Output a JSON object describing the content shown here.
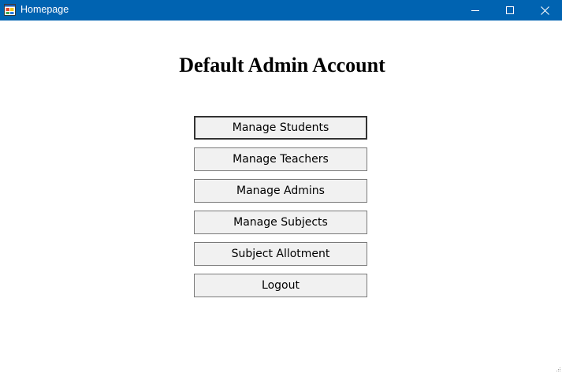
{
  "window": {
    "title": "Homepage",
    "titlebar_color": "#0063b1",
    "controls": {
      "minimize_icon": "minimize-icon",
      "maximize_icon": "maximize-icon",
      "close_icon": "close-icon"
    }
  },
  "main": {
    "heading": "Default Admin Account",
    "buttons": [
      {
        "label": "Manage Students"
      },
      {
        "label": "Manage Teachers"
      },
      {
        "label": "Manage Admins"
      },
      {
        "label": "Manage Subjects"
      },
      {
        "label": "Subject Allotment"
      },
      {
        "label": "Logout"
      }
    ]
  }
}
